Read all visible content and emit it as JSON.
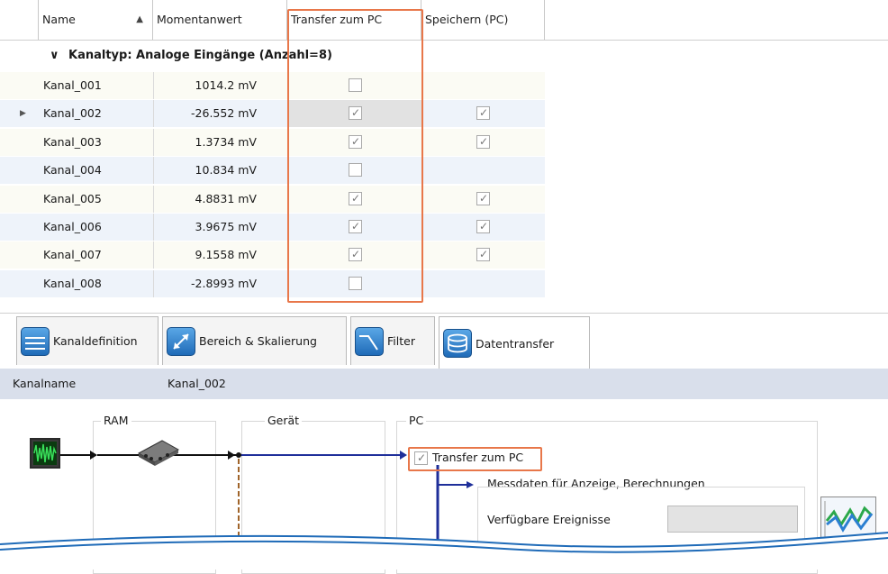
{
  "table": {
    "columns": [
      "Name",
      "Momentanwert",
      "Transfer zum PC",
      "Speichern (PC)"
    ],
    "group_label": "Kanaltyp: Analoge Eingänge (Anzahl=8)",
    "rows": [
      {
        "name": "Kanal_001",
        "value": "1014.2 mV",
        "transfer": false,
        "save": null
      },
      {
        "name": "Kanal_002",
        "value": "-26.552 mV",
        "transfer": true,
        "save": true
      },
      {
        "name": "Kanal_003",
        "value": "1.3734 mV",
        "transfer": true,
        "save": true
      },
      {
        "name": "Kanal_004",
        "value": "10.834 mV",
        "transfer": false,
        "save": null
      },
      {
        "name": "Kanal_005",
        "value": "4.8831 mV",
        "transfer": true,
        "save": true
      },
      {
        "name": "Kanal_006",
        "value": "3.9675 mV",
        "transfer": true,
        "save": true
      },
      {
        "name": "Kanal_007",
        "value": "9.1558 mV",
        "transfer": true,
        "save": true
      },
      {
        "name": "Kanal_008",
        "value": "-2.8993 mV",
        "transfer": false,
        "save": null
      }
    ]
  },
  "tabs": [
    {
      "label": "Kanaldefinition",
      "icon": "channel-definition-icon"
    },
    {
      "label": "Bereich & Skalierung",
      "icon": "range-scaling-icon"
    },
    {
      "label": "Filter",
      "icon": "filter-icon"
    },
    {
      "label": "Datentransfer",
      "icon": "data-transfer-icon"
    }
  ],
  "detail": {
    "channel_label": "Kanalname",
    "channel_value": "Kanal_002",
    "ram_label": "RAM",
    "device_label": "Gerät",
    "pc_label": "PC",
    "transfer_label": "Transfer zum PC",
    "measure_label": "Messdaten für Anzeige, Berechnungen",
    "events_label": "Verfügbare Ereignisse"
  },
  "colors": {
    "highlight": "#e8774a",
    "flow": "#1f2f9a",
    "accent": "#1f6bb8"
  }
}
